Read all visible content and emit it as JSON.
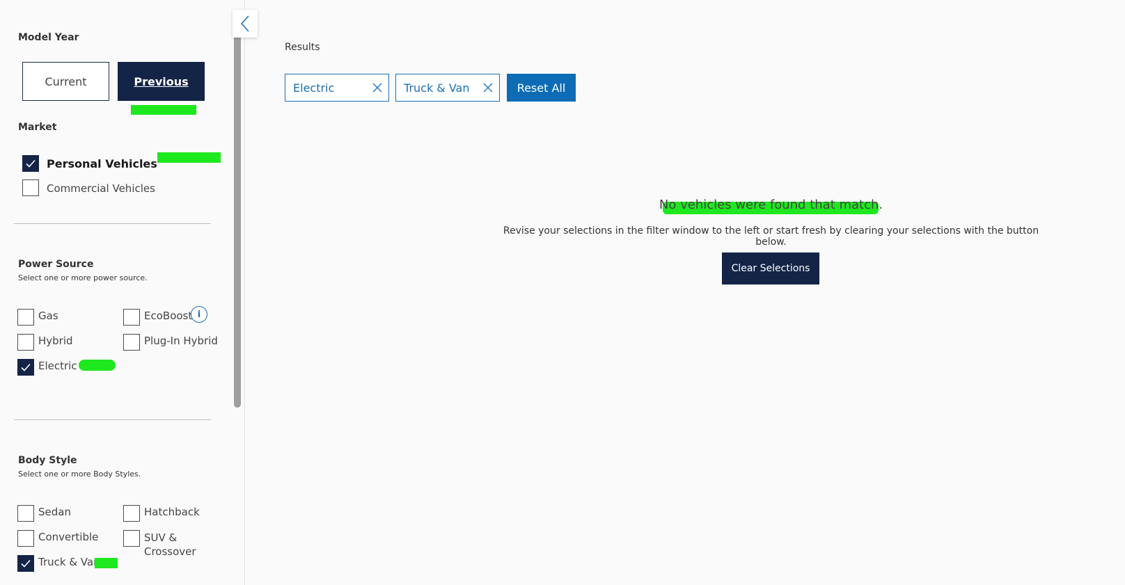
{
  "sidebar": {
    "model_year": {
      "title": "Model Year",
      "current_label": "Current",
      "previous_label": "Previous",
      "selected": "Previous"
    },
    "market": {
      "title": "Market",
      "options": [
        {
          "label": "Personal Vehicles",
          "checked": true
        },
        {
          "label": "Commercial Vehicles",
          "checked": false
        }
      ]
    },
    "power_source": {
      "title": "Power Source",
      "subtitle": "Select one or more power source.",
      "options": [
        {
          "label": "Gas",
          "checked": false
        },
        {
          "label": "EcoBoost",
          "checked": false
        },
        {
          "label": "Hybrid",
          "checked": false
        },
        {
          "label": "Plug-In Hybrid",
          "checked": false
        },
        {
          "label": "Electric",
          "checked": true
        }
      ],
      "info_icon": "i"
    },
    "body_style": {
      "title": "Body Style",
      "subtitle": "Select one or more Body Styles.",
      "options": [
        {
          "label": "Sedan",
          "checked": false
        },
        {
          "label": "Hatchback",
          "checked": false
        },
        {
          "label": "Convertible",
          "checked": false
        },
        {
          "label": "SUV & Crossover",
          "checked": false
        },
        {
          "label": "Truck & Van",
          "checked": true
        }
      ]
    }
  },
  "main": {
    "results_label": "Results",
    "chips": [
      {
        "label": "Electric"
      },
      {
        "label": "Truck & Van"
      }
    ],
    "reset_label": "Reset All",
    "empty_title": "No vehicles were found that match.",
    "empty_message": "Revise your selections in the filter window to the left or start fresh by clearing your selections with the button below.",
    "clear_label": "Clear Selections"
  },
  "colors": {
    "navy": "#132447",
    "accent_blue": "#0d6cb5",
    "highlight": "#1ee81e"
  }
}
